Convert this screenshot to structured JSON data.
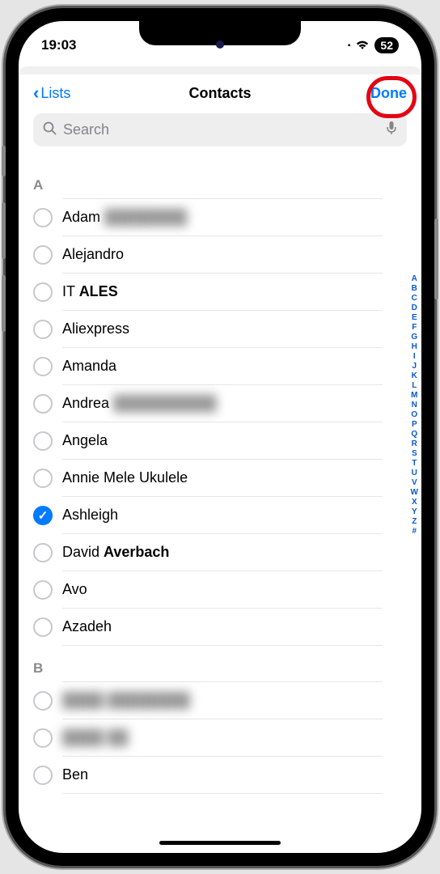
{
  "status": {
    "time": "19:03",
    "battery": "52"
  },
  "nav": {
    "back_label": "Lists",
    "title": "Contacts",
    "done_label": "Done"
  },
  "search": {
    "placeholder": "Search"
  },
  "sections": [
    {
      "letter": "A",
      "contacts": [
        {
          "first": "Adam",
          "last_blur": true,
          "last": "████████",
          "checked": false
        },
        {
          "first": "Alejandro",
          "last": "",
          "checked": false
        },
        {
          "first": "IT",
          "last": "ALES",
          "checked": false
        },
        {
          "first": "Aliexpress",
          "last": "",
          "checked": false
        },
        {
          "first": "Amanda",
          "last": "",
          "checked": false
        },
        {
          "first": "Andrea",
          "last_blur": true,
          "last": "██████████",
          "checked": false
        },
        {
          "first": "Angela",
          "last": "",
          "checked": false
        },
        {
          "first": "Annie Mele Ukulele",
          "last": "",
          "checked": false
        },
        {
          "first": "Ashleigh",
          "last": "",
          "checked": true
        },
        {
          "first": "David",
          "last": "Averbach",
          "checked": false
        },
        {
          "first": "Avo",
          "last": "",
          "checked": false
        },
        {
          "first": "Azadeh",
          "last": "",
          "checked": false
        }
      ]
    },
    {
      "letter": "B",
      "contacts": [
        {
          "first_blur": true,
          "first": "████ ████████",
          "last": "",
          "checked": false
        },
        {
          "first_blur": true,
          "first": "████ ██",
          "last": "",
          "checked": false
        },
        {
          "first": "Ben",
          "last": "",
          "checked": false
        }
      ]
    }
  ],
  "index_bar": [
    "A",
    "B",
    "C",
    "D",
    "E",
    "F",
    "G",
    "H",
    "I",
    "J",
    "K",
    "L",
    "M",
    "N",
    "O",
    "P",
    "Q",
    "R",
    "S",
    "T",
    "U",
    "V",
    "W",
    "X",
    "Y",
    "Z",
    "#"
  ]
}
